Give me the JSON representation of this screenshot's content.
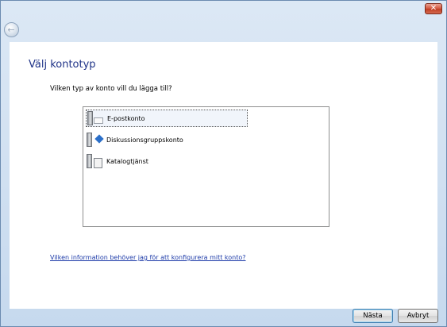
{
  "window": {
    "back_icon": "back-arrow-icon",
    "close_icon": "close-icon",
    "close_glyph": "✕",
    "back_glyph": "←"
  },
  "page": {
    "heading": "Välj kontotyp",
    "question": "Vilken typ av konto vill du lägga till?"
  },
  "account_types": [
    {
      "label": "E-postkonto",
      "icon": "email-account-icon",
      "selected": true
    },
    {
      "label": "Diskussionsgruppskonto",
      "icon": "newsgroup-account-icon",
      "selected": false
    },
    {
      "label": "Katalogtjänst",
      "icon": "directory-service-icon",
      "selected": false
    }
  ],
  "help_link": "Vilken information behöver jag för att konfigurera mitt konto?",
  "buttons": {
    "next": "Nästa",
    "cancel": "Avbryt"
  }
}
